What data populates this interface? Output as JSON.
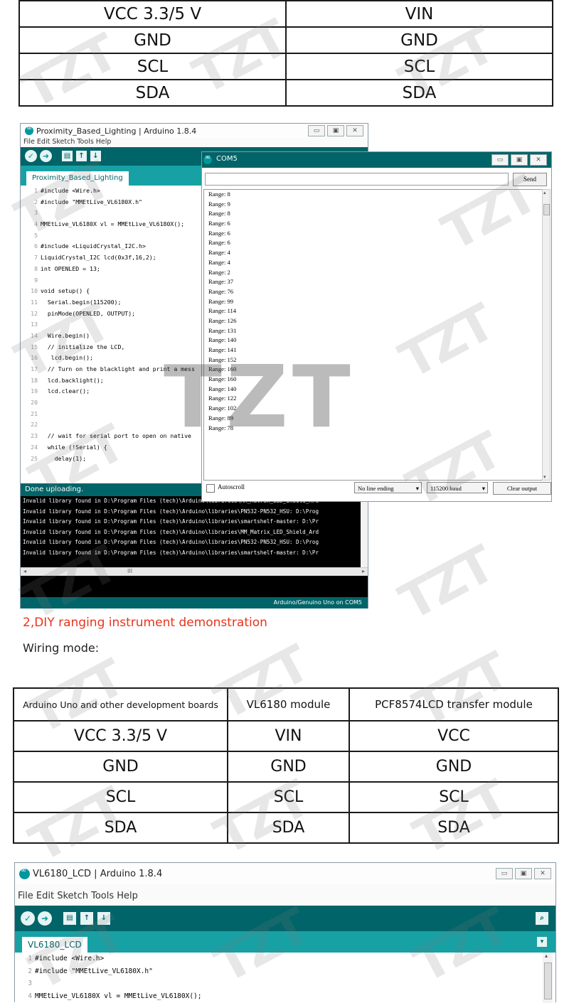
{
  "table1": {
    "rows": [
      [
        "VCC 3.3/5 V",
        "VIN"
      ],
      [
        "GND",
        "GND"
      ],
      [
        "SCL",
        "SCL"
      ],
      [
        "SDA",
        "SDA"
      ]
    ]
  },
  "ide1": {
    "title": "Proximity_Based_Lighting | Arduino 1.8.4",
    "menu": "File  Edit  Sketch  Tools  Help",
    "tab": "Proximity_Based_Lighting",
    "status": "Done uploading.",
    "board": "Arduino/Genuino Uno on COM5",
    "code": [
      {
        "n": "1",
        "t": "#include <Wire.h>"
      },
      {
        "n": "2",
        "t": "#include \"MMEtLive_VL6180X.h\""
      },
      {
        "n": "3",
        "t": ""
      },
      {
        "n": "4",
        "t": "MMEtLive_VL6180X vl = MMEtLive_VL6180X();"
      },
      {
        "n": "5",
        "t": ""
      },
      {
        "n": "6",
        "t": "#include <LiquidCrystal_I2C.h>"
      },
      {
        "n": "7",
        "t": "LiquidCrystal_I2C lcd(0x3f,16,2);"
      },
      {
        "n": "8",
        "t": "int OPENLED = 13;"
      },
      {
        "n": "9",
        "t": ""
      },
      {
        "n": "10",
        "t": "void setup() {"
      },
      {
        "n": "11",
        "t": "  Serial.begin(115200);"
      },
      {
        "n": "12",
        "t": "  pinMode(OPENLED, OUTPUT);"
      },
      {
        "n": "13",
        "t": ""
      },
      {
        "n": "14",
        "t": "  Wire.begin()"
      },
      {
        "n": "15",
        "t": "  // initialize the LCD,"
      },
      {
        "n": "16",
        "t": "   lcd.begin();"
      },
      {
        "n": "17",
        "t": "  // Turn on the blacklight and print a mess"
      },
      {
        "n": "18",
        "t": "  lcd.backlight();"
      },
      {
        "n": "19",
        "t": "  lcd.clear();"
      },
      {
        "n": "20",
        "t": ""
      },
      {
        "n": "21",
        "t": ""
      },
      {
        "n": "22",
        "t": ""
      },
      {
        "n": "23",
        "t": "  // wait for serial port to open on native"
      },
      {
        "n": "24",
        "t": "  while (!Serial) {"
      },
      {
        "n": "25",
        "t": "    delay(1);"
      }
    ],
    "console": [
      "Invalid library found in D:\\Program Files (tech)\\Arduino\\libraries\\MM_Matrix_LED_Shield_Ard",
      "Invalid library found in D:\\Program Files (tech)\\Arduino\\libraries\\PN532-PN532_HSU: D:\\Prog",
      "Invalid library found in D:\\Program Files (tech)\\Arduino\\libraries\\smartshelf-master: D:\\Pr",
      "Invalid library found in D:\\Program Files (tech)\\Arduino\\libraries\\MM_Matrix_LED_Shield_Ard",
      "Invalid library found in D:\\Program Files (tech)\\Arduino\\libraries\\PN532-PN532_HSU: D:\\Prog",
      "Invalid library found in D:\\Program Files (tech)\\Arduino\\libraries\\smartshelf-master: D:\\Pr"
    ],
    "hscroll": "III"
  },
  "serial": {
    "title": "COM5",
    "send": "Send",
    "label": "Range: ",
    "values": [
      "8",
      "9",
      "8",
      "6",
      "6",
      "6",
      "4",
      "4",
      "2",
      "37",
      "76",
      "99",
      "114",
      "126",
      "131",
      "140",
      "141",
      "152",
      "160",
      "160",
      "140",
      "122",
      "102",
      "89",
      "78"
    ],
    "autoscroll": "Autoscroll",
    "line_ending": "No line ending",
    "baud": "115200 baud",
    "clear": "Clear output"
  },
  "section": {
    "heading": "2,DIY ranging instrument demonstration",
    "heading_color": "#e8341c",
    "wiring": "Wiring mode:"
  },
  "table2": {
    "headers": [
      "Arduino Uno and other development boards",
      "VL6180 module",
      "PCF8574LCD transfer module"
    ],
    "rows": [
      [
        "VCC 3.3/5 V",
        "VIN",
        "VCC"
      ],
      [
        "GND",
        "GND",
        "GND"
      ],
      [
        "SCL",
        "SCL",
        "SCL"
      ],
      [
        "SDA",
        "SDA",
        "SDA"
      ]
    ]
  },
  "ide2": {
    "title": "VL6180_LCD | Arduino 1.8.4",
    "menu": "File  Edit  Sketch  Tools  Help",
    "tab": "VL6180_LCD",
    "code": [
      {
        "n": "1",
        "t": "#include <Wire.h>"
      },
      {
        "n": "2",
        "t": "#include \"MMEtLive_VL6180X.h\""
      },
      {
        "n": "3",
        "t": ""
      },
      {
        "n": "4",
        "t": "MMEtLive_VL6180X vl = MMEtLive_VL6180X();"
      }
    ]
  },
  "watermark": "TZT",
  "colors": {
    "arduino_dark": "#006468",
    "arduino_teal": "#17a1a5",
    "arduino_logo": "#00979c"
  }
}
